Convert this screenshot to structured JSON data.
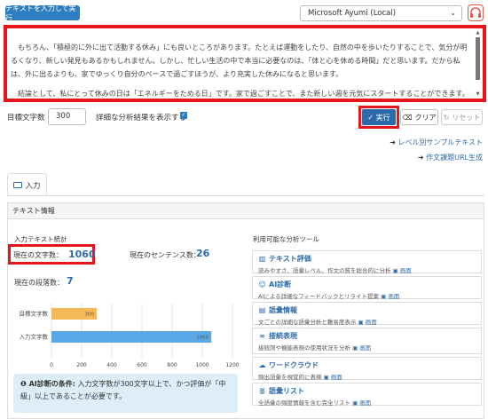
{
  "top_button": "テキストを入力して実行",
  "voice_select": {
    "value": "Microsoft Ayumi (Local)",
    "arrow": "⌄"
  },
  "textarea": {
    "paragraph1": "もちろん、「積極的に外に出て活動する休み」にも良いところがあります。たとえば運動をしたり、自然の中を歩いたりすることで、気分が明るくなり、新しい発見もあるかもしれません。しかし、忙しい生活の中で本当に必要なのは、「体と心を休める時間」だと思います。だから私は、外に出るよりも、家でゆっくり自分のペースで過ごすほうが、より充実した休みになると思います。",
    "paragraph2": "結論として、私にとって休みの日は「エネルギーをためる日」です。家で過ごすことで、また新しい週を元気にスタートすることができます。外に出て楽しいこともありますが、私には家での時間が何よりも大切です。"
  },
  "controls": {
    "target_label": "目標文字数",
    "target_value": "300",
    "detail_label": "詳細な分析結果を表示する",
    "run_label": "✓ 実行",
    "clear_label": "クリア",
    "reset_label": "リセット"
  },
  "links": {
    "level_sample": "レベル別サンプルテキスト",
    "task_url": "作文課題URL生成"
  },
  "tabs": [
    {
      "label": "入力"
    }
  ],
  "panel": {
    "header": "テキスト情報",
    "stats_title": "入力テキスト統計",
    "char_count_label": "現在の文字数：",
    "char_count": "1060",
    "sentence_label": "現在のセンテンス数：",
    "sentence_count": "26",
    "paragraph_label": "現在の段落数：",
    "paragraph_count": "7",
    "note_title": "AI診断の条件:",
    "note_text": "入力文字数が300文字以上で、かつ評価が「中級」以上であることが必要です。"
  },
  "chart_data": {
    "type": "bar",
    "orientation": "horizontal",
    "categories": [
      "目標文字数",
      "入力文字数"
    ],
    "values": [
      300,
      1060
    ],
    "colors": [
      "#f5b95a",
      "#5aa9e6"
    ],
    "xlim": [
      0,
      1200
    ],
    "xticks": [
      "0",
      "200",
      "400",
      "600",
      "800",
      "1000",
      "1200"
    ]
  },
  "tools": {
    "title": "利用可能な分析ツール",
    "screen_label": "画面",
    "items": [
      {
        "icon": "chart-icon",
        "name": "テキスト評価",
        "desc": "読みやすさ、語彙レベル、作文の質を総合的に分析"
      },
      {
        "icon": "robot-icon",
        "name": "AI診断",
        "desc": "AIによる詳細なフィードバックとリライト提案"
      },
      {
        "icon": "book-icon",
        "name": "語彙情報",
        "desc": "文ごとの詳細な語彙分析と難易度表示"
      },
      {
        "icon": "link-icon",
        "name": "接続表現",
        "desc": "接続詞や機能表現の使用状況を分析"
      },
      {
        "icon": "cloud-icon",
        "name": "ワードクラウド",
        "desc": "頻出語彙を視覚的に表現"
      },
      {
        "icon": "list-icon",
        "name": "語彙リスト",
        "desc": "全語彙の頻度情報を含む完全リスト"
      }
    ]
  },
  "colors": {
    "accent": "#2d6aa9",
    "highlight": "#e4161b",
    "top_button": "#2d7fc1"
  }
}
